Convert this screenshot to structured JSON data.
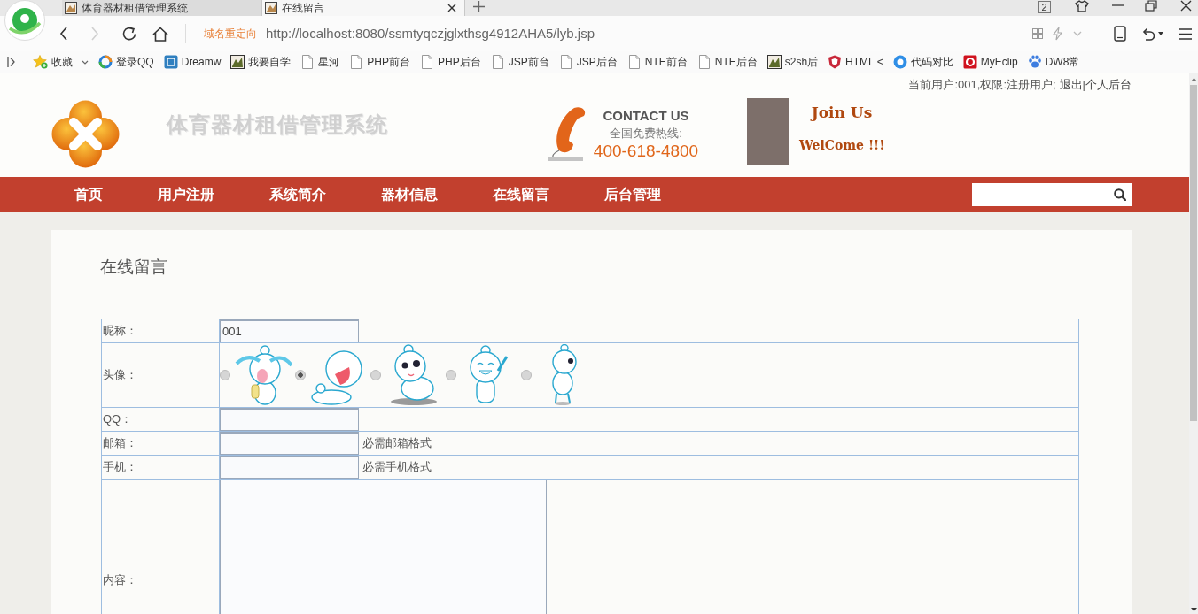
{
  "browser": {
    "tabs": [
      {
        "title": "体育器材租借管理系统",
        "selected": false
      },
      {
        "title": "在线留言",
        "selected": true
      }
    ],
    "tab_count": "2",
    "forward_enabled": false,
    "redirect_label": "域名重定向",
    "url": "http://localhost:8080/ssmtyqczjglxthsg4912AHA5/lyb.jsp",
    "favorites": {
      "label": "收藏"
    },
    "bookmarks": [
      {
        "kind": "ring",
        "label": "登录QQ"
      },
      {
        "kind": "tile",
        "label": "Dreamw"
      },
      {
        "kind": "image",
        "label": "我要自学"
      },
      {
        "kind": "page",
        "label": "星河"
      },
      {
        "kind": "page",
        "label": "PHP前台"
      },
      {
        "kind": "page",
        "label": "PHP后台"
      },
      {
        "kind": "page",
        "label": "JSP前台"
      },
      {
        "kind": "page",
        "label": "JSP后台"
      },
      {
        "kind": "page",
        "label": "NTE前台"
      },
      {
        "kind": "page",
        "label": "NTE后台"
      },
      {
        "kind": "image",
        "label": "s2sh后"
      },
      {
        "kind": "shield",
        "label": "HTML <"
      },
      {
        "kind": "disc",
        "label": "代码对比"
      },
      {
        "kind": "square",
        "label": "MyEclip"
      },
      {
        "kind": "paw",
        "label": "DW8常"
      }
    ]
  },
  "header": {
    "user_info": "当前用户:001,权限:注册用户;",
    "logout": "退出",
    "separator": "|",
    "personal": "个人后台",
    "site_title": "体育器材租借管理系统",
    "contact_title": "CONTACT US",
    "hotline_label": "全国免费热线:",
    "hotline": "400-618-4800",
    "join": "Join Us",
    "welcome": "WelCome !!!"
  },
  "nav": {
    "items": [
      "首页",
      "用户注册",
      "系统简介",
      "器材信息",
      "在线留言",
      "后台管理"
    ]
  },
  "form": {
    "title": "在线留言",
    "rows": [
      {
        "kind": "text",
        "label": "昵称：",
        "value": "001"
      },
      {
        "kind": "avatar",
        "label": "头像：",
        "options": [
          {
            "kind": "crying",
            "selected": false
          },
          {
            "kind": "laughing",
            "selected": true
          },
          {
            "kind": "shy",
            "selected": false
          },
          {
            "kind": "cheering",
            "selected": false
          },
          {
            "kind": "standing",
            "selected": false
          }
        ]
      },
      {
        "kind": "text",
        "label": "QQ："
      },
      {
        "kind": "text",
        "label": "邮箱：",
        "hint": "必需邮箱格式"
      },
      {
        "kind": "text",
        "label": "手机：",
        "hint": "必需手机格式"
      },
      {
        "kind": "textarea",
        "label": "内容："
      }
    ]
  }
}
